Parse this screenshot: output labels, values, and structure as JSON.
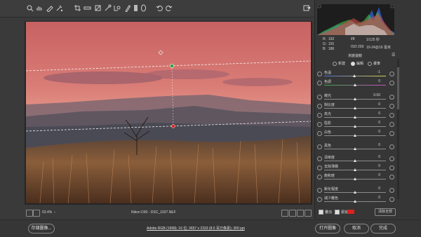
{
  "toolbar": {
    "tools": [
      "zoom-tool",
      "hand-tool",
      "white-balance-tool",
      "color-sampler-tool",
      "crop-tool",
      "straighten-tool",
      "transform-tool",
      "spot-removal-tool",
      "red-eye-tool",
      "adjustment-brush-tool",
      "graduated-filter-tool",
      "radial-filter-tool",
      "rotate-left-tool",
      "rotate-right-tool"
    ],
    "export_icon": "export-icon"
  },
  "histogram": {
    "r_label": "R:",
    "r_value": "192",
    "g_label": "G:",
    "g_value": "191",
    "b_label": "B:",
    "b_value": "186",
    "aperture": "f/8",
    "shutter": "1/125 秒",
    "iso": "ISO 200",
    "lens": "10-24@19 毫米"
  },
  "panel": {
    "title": "漸變濾鏡",
    "mode_new": "新建",
    "mode_edit": "編輯",
    "mode_brush": "畫筆",
    "sliders": [
      {
        "name": "色溫",
        "value": "-1",
        "knob": 0.49
      },
      {
        "name": "色調",
        "value": "0",
        "knob": 0.5
      },
      {
        "name": "曝光",
        "value": "0.00",
        "knob": 0.5
      },
      {
        "name": "對比度",
        "value": "0",
        "knob": 0.5
      },
      {
        "name": "高光",
        "value": "0",
        "knob": 0.5
      },
      {
        "name": "陰影",
        "value": "0",
        "knob": 0.5
      },
      {
        "name": "白色",
        "value": "0",
        "knob": 0.5
      },
      {
        "name": "黑色",
        "value": "0",
        "knob": 0.5
      },
      {
        "name": "清晰度",
        "value": "0",
        "knob": 0.5
      },
      {
        "name": "去除薄霧",
        "value": "0",
        "knob": 0.5
      },
      {
        "name": "飽和度",
        "value": "0",
        "knob": 0.5
      },
      {
        "name": "銳化程度",
        "value": "0",
        "knob": 0.5
      },
      {
        "name": "減少雜色",
        "value": "0",
        "knob": 0.5
      }
    ],
    "overlay_label": "疊加",
    "mask_label": "蒙版",
    "mask_color": "#e0201c",
    "clear_all": "清除全部"
  },
  "status": {
    "zoom": "53.4%",
    "filename": "Nikon D90 - DSC_1037.NEF"
  },
  "bottom": {
    "save_button": "存儲圖像...",
    "workflow_link": "Adobe RGB (1998); 16 位; 3657 x 2333 (8.5 百万像素); 300 ppi",
    "open_button": "打开圖像",
    "cancel_button": "取消",
    "done_button": "完成"
  }
}
